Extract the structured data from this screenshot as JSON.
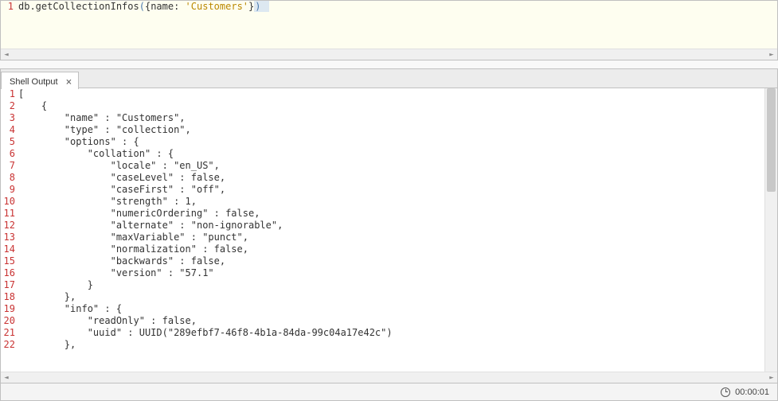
{
  "input": {
    "lineNumbers": [
      "1"
    ],
    "code": {
      "prefix": "db.getCollectionInfos",
      "openParen": "(",
      "openBrace": "{",
      "key": "name: ",
      "string": "'Customers'",
      "closeBrace": "}",
      "closeParen": ")"
    }
  },
  "tab": {
    "label": "Shell Output"
  },
  "output": {
    "lineNumbers": [
      "1",
      "2",
      "3",
      "4",
      "5",
      "6",
      "7",
      "8",
      "9",
      "10",
      "11",
      "12",
      "13",
      "14",
      "15",
      "16",
      "17",
      "18",
      "19",
      "20",
      "21",
      "22"
    ],
    "lines": [
      "[",
      "    {",
      "        \"name\" : \"Customers\",",
      "        \"type\" : \"collection\",",
      "        \"options\" : {",
      "            \"collation\" : {",
      "                \"locale\" : \"en_US\",",
      "                \"caseLevel\" : false,",
      "                \"caseFirst\" : \"off\",",
      "                \"strength\" : 1,",
      "                \"numericOrdering\" : false,",
      "                \"alternate\" : \"non-ignorable\",",
      "                \"maxVariable\" : \"punct\",",
      "                \"normalization\" : false,",
      "                \"backwards\" : false,",
      "                \"version\" : \"57.1\"",
      "            }",
      "        },",
      "        \"info\" : {",
      "            \"readOnly\" : false,",
      "            \"uuid\" : UUID(\"289efbf7-46f8-4b1a-84da-99c04a17e42c\")",
      "        },"
    ]
  },
  "status": {
    "time": "00:00:01"
  }
}
